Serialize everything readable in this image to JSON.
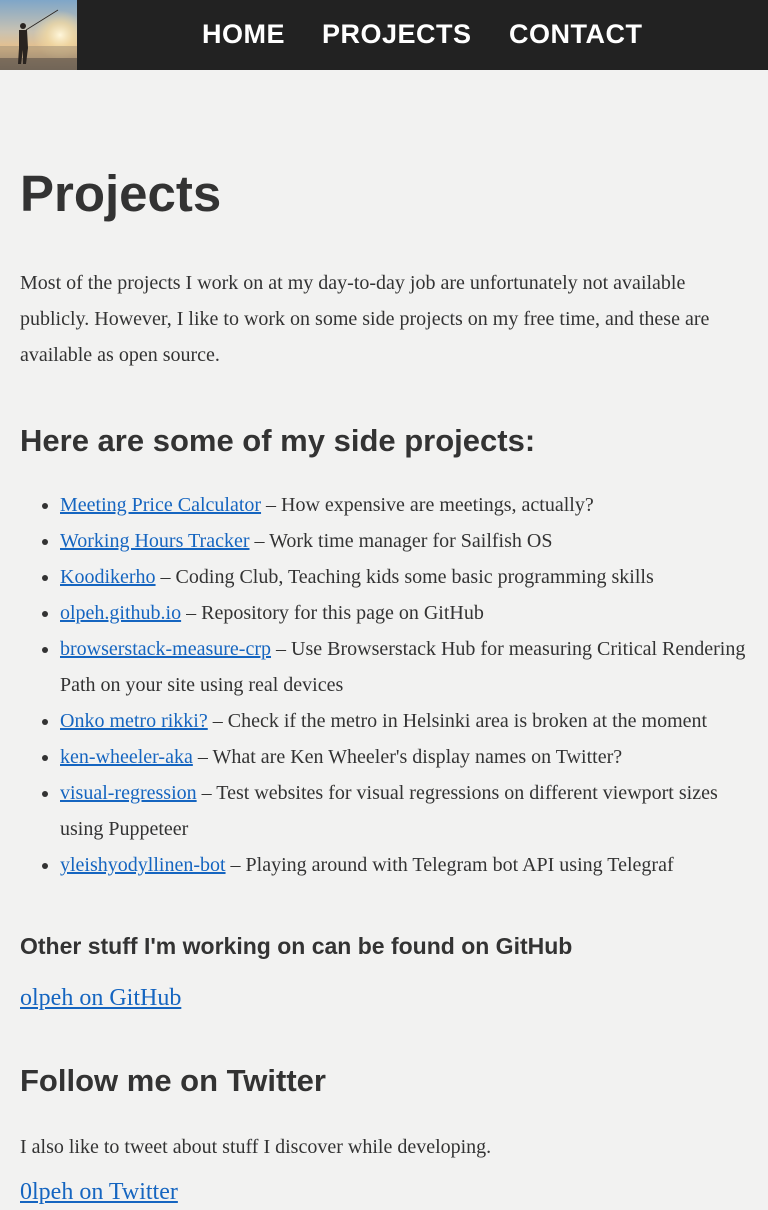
{
  "colors": {
    "header_bg": "#222222",
    "page_bg": "#f2f2f1",
    "text": "#333333",
    "link": "#1565c0"
  },
  "nav": {
    "items": [
      {
        "label": "HOME"
      },
      {
        "label": "PROJECTS"
      },
      {
        "label": "CONTACT"
      }
    ]
  },
  "logo": {
    "icon": "fisherman-sunset-icon"
  },
  "main": {
    "title": "Projects",
    "intro": "Most of the projects I work on at my day-to-day job are unfortunately not available publicly. However, I like to work on some side projects on my free time, and these are available as open source.",
    "side_projects_heading": "Here are some of my side projects:",
    "projects": [
      {
        "name": "Meeting Price Calculator",
        "description": " – How expensive are meetings, actually?"
      },
      {
        "name": "Working Hours Tracker",
        "description": " – Work time manager for Sailfish OS"
      },
      {
        "name": "Koodikerho",
        "description": " – Coding Club, Teaching kids some basic programming skills"
      },
      {
        "name": "olpeh.github.io",
        "description": " – Repository for this page on GitHub"
      },
      {
        "name": "browserstack-measure-crp",
        "description": " – Use Browserstack Hub for measuring Critical Rendering Path on your site using real devices"
      },
      {
        "name": "Onko metro rikki?",
        "description": " – Check if the metro in Helsinki area is broken at the moment"
      },
      {
        "name": "ken-wheeler-aka",
        "description": " – What are Ken Wheeler's display names on Twitter?"
      },
      {
        "name": "visual-regression",
        "description": " – Test websites for visual regressions on different viewport sizes using Puppeteer"
      },
      {
        "name": "yleishyodyllinen-bot",
        "description": " – Playing around with Telegram bot API using Telegraf"
      }
    ],
    "github_heading": "Other stuff I'm working on can be found on GitHub",
    "github_link": "olpeh on GitHub",
    "twitter_heading": "Follow me on Twitter",
    "twitter_text": "I also like to tweet about stuff I discover while developing.",
    "twitter_link": "0lpeh on Twitter"
  }
}
